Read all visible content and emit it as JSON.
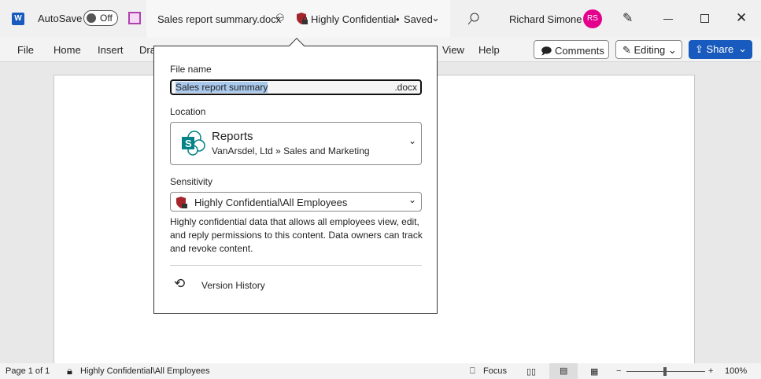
{
  "titlebar": {
    "app_icon": "W",
    "autosave_label": "AutoSave",
    "autosave_state": "Off",
    "document_title": "Sales report summary.docx",
    "sensitivity": "Highly Confidential",
    "separator": "•",
    "save_status": "Saved",
    "user_name": "Richard Simone",
    "user_initials": "RS"
  },
  "ribbon": {
    "tabs": [
      "File",
      "Home",
      "Insert",
      "Dra",
      "View",
      "Help"
    ],
    "comments_label": "Comments",
    "editing_label": "Editing",
    "share_label": "Share"
  },
  "popup": {
    "file_name_label": "File name",
    "file_name_value": "Sales report summary",
    "file_extension": ".docx",
    "location_label": "Location",
    "location_name": "Reports",
    "location_path": "VanArsdel, Ltd » Sales and Marketing",
    "sensitivity_label": "Sensitivity",
    "sensitivity_value": "Highly Confidential\\All Employees",
    "sensitivity_description": "Highly confidential data that allows all employees view, edit, and reply permissions to this content. Data owners can track and revoke content.",
    "version_history_label": "Version History"
  },
  "statusbar": {
    "page_info": "Page 1 of 1",
    "sensitivity": "Highly Confidential\\All Employees",
    "focus_label": "Focus",
    "zoom_level": "100%",
    "zoom_minus": "−",
    "zoom_plus": "+"
  },
  "colors": {
    "accent": "#185abd",
    "avatar": "#e3008c",
    "sensitivity_shield": "#a4262c",
    "sharepoint": "#038387"
  }
}
